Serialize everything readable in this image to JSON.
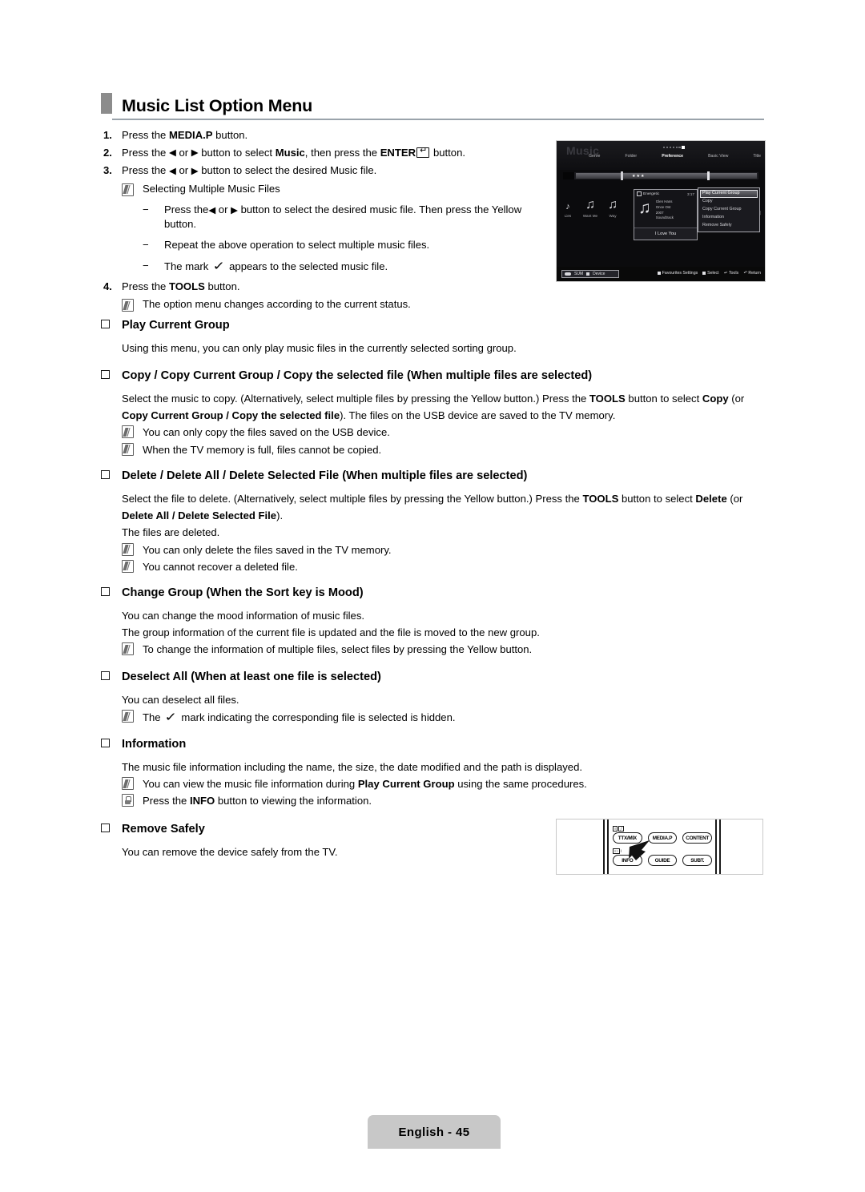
{
  "page": {
    "title": "Music List Option Menu",
    "footer_label": "English - 45"
  },
  "steps": [
    {
      "num": "1.",
      "parts": [
        {
          "t": "Press the ",
          "b": false
        },
        {
          "t": "MEDIA.P",
          "b": true
        },
        {
          "t": " button.",
          "b": false
        }
      ]
    },
    {
      "num": "2.",
      "parts": [
        {
          "t": "Press the ",
          "b": false
        },
        {
          "t": "◀",
          "b": false
        },
        {
          "t": " or ",
          "b": false
        },
        {
          "t": "▶",
          "b": false
        },
        {
          "t": " button to select ",
          "b": false
        },
        {
          "t": "Music",
          "b": true
        },
        {
          "t": ", then press the ",
          "b": false
        },
        {
          "t": "ENTER",
          "b": true
        },
        {
          "t": "ENTERKEY",
          "b": false
        },
        {
          "t": " button.",
          "b": false
        }
      ]
    },
    {
      "num": "3.",
      "parts": [
        {
          "t": "Press the ",
          "b": false
        },
        {
          "t": "◀",
          "b": false
        },
        {
          "t": " or ",
          "b": false
        },
        {
          "t": "▶",
          "b": false
        },
        {
          "t": " button to select the desired Music file.",
          "b": false
        }
      ]
    }
  ],
  "step3_note": "Selecting Multiple Music Files",
  "substeps": [
    "Press the ◀ or ▶ button to select the desired music file. Then press the Yellow button.",
    "Repeat the above operation to select multiple music files.",
    "The mark ✓ appears to the selected music file."
  ],
  "step4": {
    "num": "4.",
    "pre": "Press the ",
    "bold": "TOOLS",
    "post": " button.",
    "note": "The option menu changes according to the current status."
  },
  "sections": [
    {
      "heading": "Play Current Group",
      "body": "Using this menu, you can only play music files in the currently selected sorting group.",
      "notes": []
    },
    {
      "heading": "Copy / Copy Current Group / Copy the selected file (When multiple files are selected)",
      "body": "Select the music to copy. (Alternatively, select multiple files by pressing the Yellow button.) Press the TOOLS button to select Copy (or Copy Current Group / Copy the selected file). The files on the USB device are saved to the TV memory.",
      "notes": [
        "You can only copy the files saved on the USB device.",
        "When the TV memory is full, files cannot be copied."
      ]
    },
    {
      "heading": "Delete / Delete All / Delete Selected File (When multiple files are selected)",
      "body": "Select the file to delete. (Alternatively, select multiple files by pressing the Yellow button.) Press the TOOLS button to select Delete (or Delete All / Delete Selected File).",
      "body2": "The files are deleted.",
      "notes": [
        "You can only delete the files saved in the TV memory.",
        "You cannot recover a deleted file."
      ]
    },
    {
      "heading": "Change Group (When the Sort key is Mood)",
      "body": "You can change the mood information of music files.",
      "body2": "The group information of the current file is updated and the file is moved to the new group.",
      "notes": [
        "To change the information of multiple files, select files by pressing the Yellow button."
      ]
    },
    {
      "heading": "Deselect All (When at least one file is selected)",
      "body": "You can deselect all files.",
      "notes": [
        "The ✓ mark indicating the corresponding file is selected is hidden."
      ]
    },
    {
      "heading": "Information",
      "body": "The music file information including the name, the size, the date modified and the path is displayed.",
      "notes": [
        "You can view the music file information during Play Current Group using the same procedures.",
        "Press the INFO button to viewing the information."
      ]
    },
    {
      "heading": "Remove Safely",
      "body": "You can remove the device safely from the TV.",
      "notes": []
    }
  ],
  "tv_screen": {
    "title": "Music",
    "nav": [
      "Genre",
      "Folder",
      "Preference",
      "Basic View",
      "Title"
    ],
    "nav_selected": "Preference",
    "thumbnails": [
      {
        "label": "Lies"
      },
      {
        "label": "Want Me"
      },
      {
        "label": "Way"
      }
    ],
    "info_panel": {
      "mood": "Energetic",
      "duration": "3:17",
      "meta": [
        "Glen Hans",
        "Once Ost",
        "2007",
        "Soundtrack"
      ],
      "song": "I Love You"
    },
    "option_menu": [
      "Play Current Group",
      "Copy",
      "Copy Current Group",
      "Information",
      "Remove Safely"
    ],
    "option_menu_selected": "Play Current Group",
    "footer_left": [
      "SUM",
      "Device"
    ],
    "footer_right": [
      "Favourites Settings",
      "Select",
      "Tools",
      "Return"
    ]
  },
  "remote": {
    "row1": [
      "TTX/MIX",
      "MEDIA.P",
      "CONTENT"
    ],
    "row2": [
      "INFO",
      "GUIDE",
      "SUBT."
    ]
  },
  "colors": {
    "title_accent": "#8c8c8c",
    "rule": "#9aa3ab",
    "footer_badge": "#c8c8c8"
  }
}
